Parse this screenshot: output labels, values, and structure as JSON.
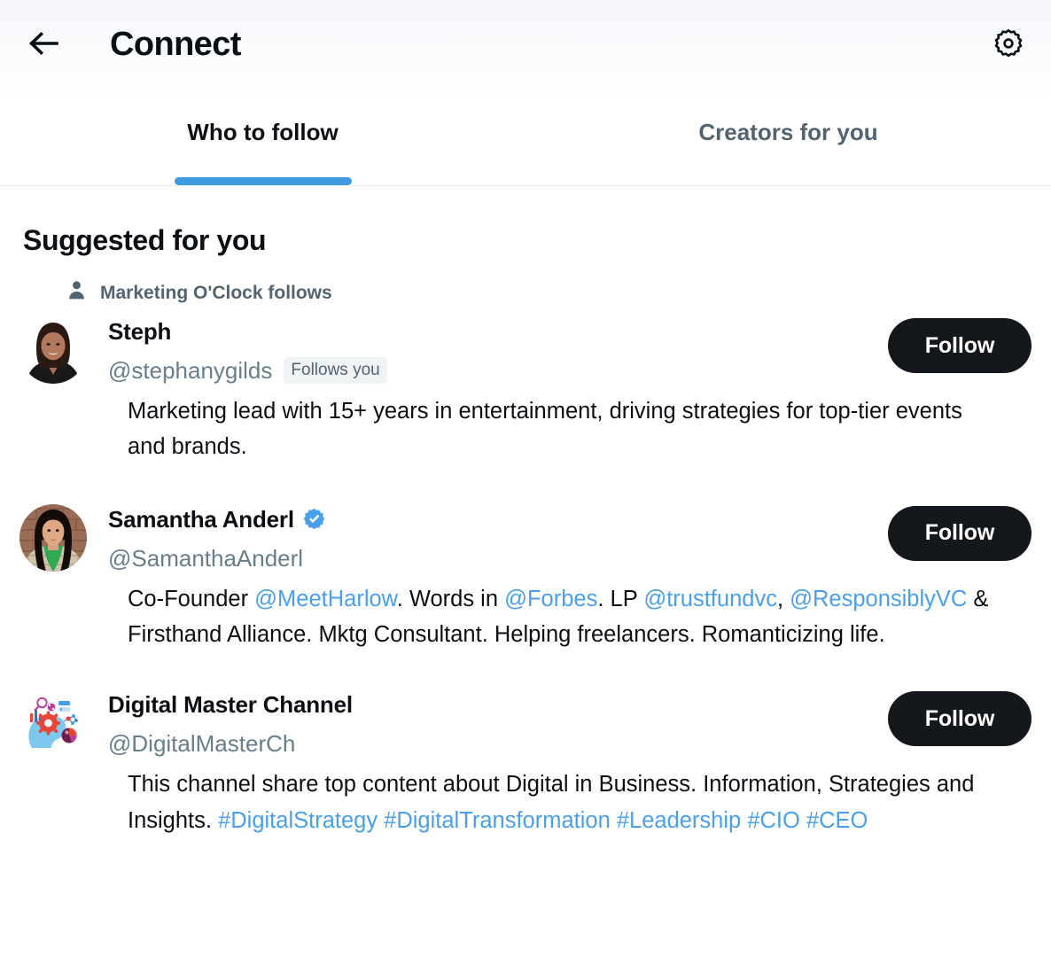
{
  "header": {
    "back_icon": "arrow-left-icon",
    "title": "Connect",
    "settings_icon": "gear-icon"
  },
  "tabs": [
    {
      "label": "Who to follow",
      "active": true
    },
    {
      "label": "Creators for you",
      "active": false
    }
  ],
  "accent_colors": {
    "tab_underline": "#3f9bdf",
    "link": "#4a9fea",
    "verified_badge": "#4a9fea",
    "follow_button_bg": "#14181c",
    "follow_button_text": "#ffffff",
    "muted_text": "#536471",
    "handle_text": "#687e8b",
    "badge_bg": "#eff3f4"
  },
  "section": {
    "title": "Suggested for you"
  },
  "suggestions": [
    {
      "social_context": "Marketing O'Clock follows",
      "social_context_icon": "person-icon",
      "avatar": "photo-woman-dark-hair-black-top",
      "display_name": "Steph",
      "verified": false,
      "handle": "@stephanygilds",
      "follows_you_label": "Follows you",
      "follow_label": "Follow",
      "bio_segments": [
        {
          "text": "Marketing lead with 15+ years in entertainment, driving strategies for top-tier events and brands.",
          "link": false
        }
      ]
    },
    {
      "social_context": null,
      "avatar": "photo-woman-green-shirt-brick-wall",
      "display_name": "Samantha Anderl",
      "verified": true,
      "verified_icon": "verified-badge-icon",
      "handle": "@SamanthaAnderl",
      "follows_you_label": null,
      "follow_label": "Follow",
      "bio_segments": [
        {
          "text": "Co-Founder ",
          "link": false
        },
        {
          "text": "@MeetHarlow",
          "link": true
        },
        {
          "text": ". Words in ",
          "link": false
        },
        {
          "text": "@Forbes",
          "link": true
        },
        {
          "text": ". LP ",
          "link": false
        },
        {
          "text": "@trustfundvc",
          "link": true
        },
        {
          "text": ", ",
          "link": false
        },
        {
          "text": "@ResponsiblyVC",
          "link": true
        },
        {
          "text": " & Firsthand Alliance. Mktg Consultant. Helping freelancers. Romanticizing life.",
          "link": false
        }
      ]
    },
    {
      "social_context": null,
      "avatar": "logo-blue-head-gear-charts",
      "display_name": "Digital Master Channel",
      "verified": false,
      "handle": "@DigitalMasterCh",
      "follows_you_label": null,
      "follow_label": "Follow",
      "bio_segments": [
        {
          "text": "This channel share top content about Digital in Business. Information, Strategies and Insights. ",
          "link": false
        },
        {
          "text": "#DigitalStrategy",
          "link": true
        },
        {
          "text": " ",
          "link": false
        },
        {
          "text": "#DigitalTransformation",
          "link": true
        },
        {
          "text": " ",
          "link": false
        },
        {
          "text": "#Leadership",
          "link": true
        },
        {
          "text": " ",
          "link": false
        },
        {
          "text": "#CIO",
          "link": true
        },
        {
          "text": " ",
          "link": false
        },
        {
          "text": "#CEO",
          "link": true
        }
      ]
    }
  ]
}
